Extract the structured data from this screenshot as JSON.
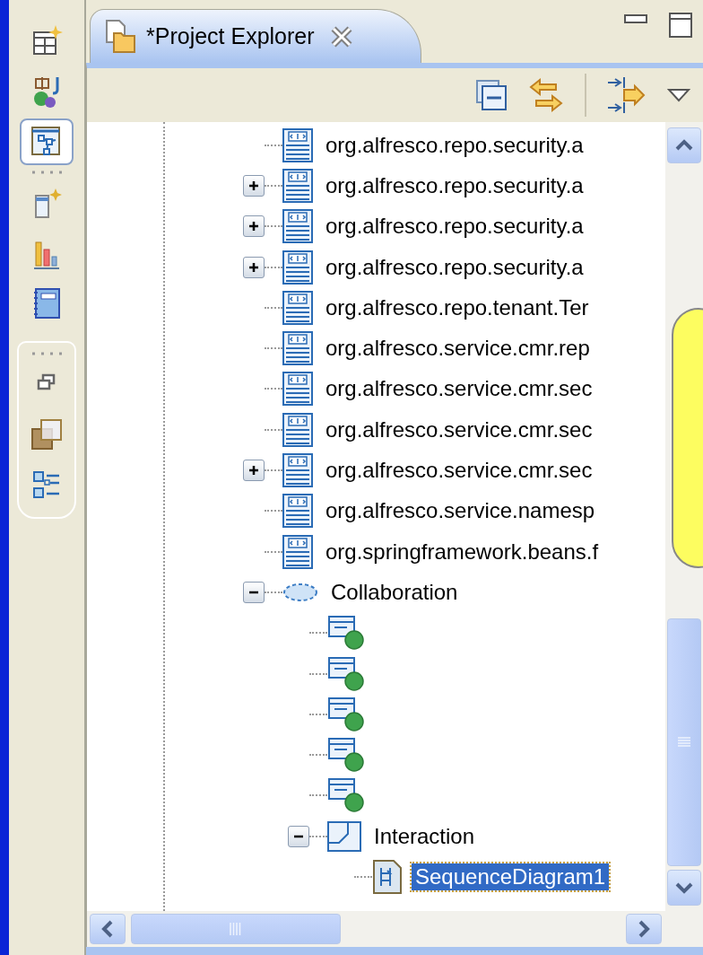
{
  "view_tab": {
    "title": "*Project Explorer",
    "selected": true
  },
  "tree": {
    "items": [
      {
        "kind": "interface",
        "label": "org.alfresco.repo.security.a"
      },
      {
        "kind": "interface",
        "label": "org.alfresco.repo.security.a",
        "expanded": false
      },
      {
        "kind": "interface",
        "label": "org.alfresco.repo.security.a",
        "expanded": false
      },
      {
        "kind": "interface",
        "label": "org.alfresco.repo.security.a",
        "expanded": false
      },
      {
        "kind": "interface",
        "label": "org.alfresco.repo.tenant.Ter"
      },
      {
        "kind": "interface",
        "label": "org.alfresco.service.cmr.rep"
      },
      {
        "kind": "interface",
        "label": "org.alfresco.service.cmr.sec"
      },
      {
        "kind": "interface",
        "label": "org.alfresco.service.cmr.sec"
      },
      {
        "kind": "interface",
        "label": "org.alfresco.service.cmr.sec",
        "expanded": false
      },
      {
        "kind": "interface",
        "label": "org.alfresco.service.namesp"
      },
      {
        "kind": "interface",
        "label": "org.springframework.beans.f"
      },
      {
        "kind": "collaboration",
        "label": "Collaboration",
        "expanded": true,
        "children": [
          {
            "kind": "lifeline"
          },
          {
            "kind": "lifeline"
          },
          {
            "kind": "lifeline"
          },
          {
            "kind": "lifeline"
          },
          {
            "kind": "lifeline"
          },
          {
            "kind": "interaction",
            "label": "Interaction",
            "expanded": true,
            "children": [
              {
                "kind": "diagram",
                "label": "SequenceDiagram1",
                "selected": true
              }
            ]
          }
        ]
      }
    ]
  }
}
